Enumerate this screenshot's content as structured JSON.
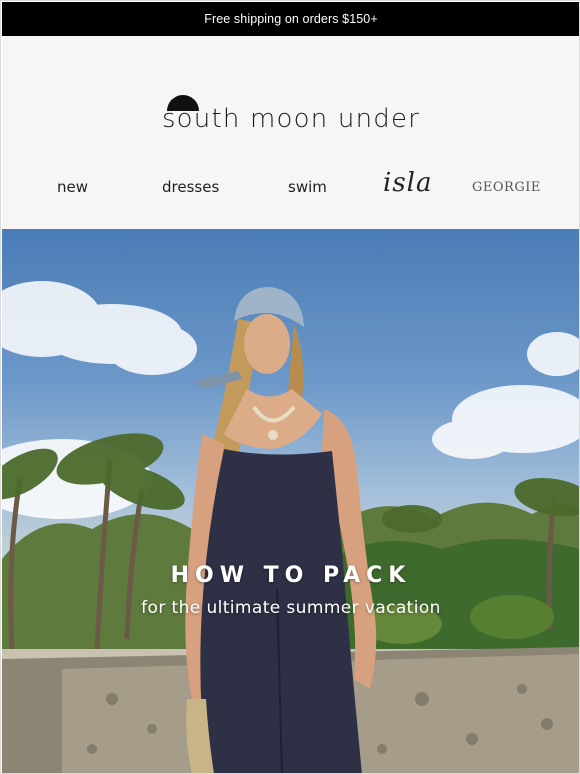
{
  "promo": {
    "text": "Free shipping on orders $150+"
  },
  "brand": {
    "logo_text": "south moon under"
  },
  "nav": {
    "items": [
      {
        "label": "new"
      },
      {
        "label": "dresses"
      },
      {
        "label": "swim"
      },
      {
        "label": "isla"
      },
      {
        "label": "GEORGIE"
      }
    ]
  },
  "hero": {
    "title": "HOW TO PACK",
    "subtitle": "for the ultimate summer vacation"
  },
  "colors": {
    "promo_bg": "#000000",
    "header_bg": "#f8f6f5",
    "hero_text": "#ffffff",
    "jumpsuit": "#2e3046"
  }
}
